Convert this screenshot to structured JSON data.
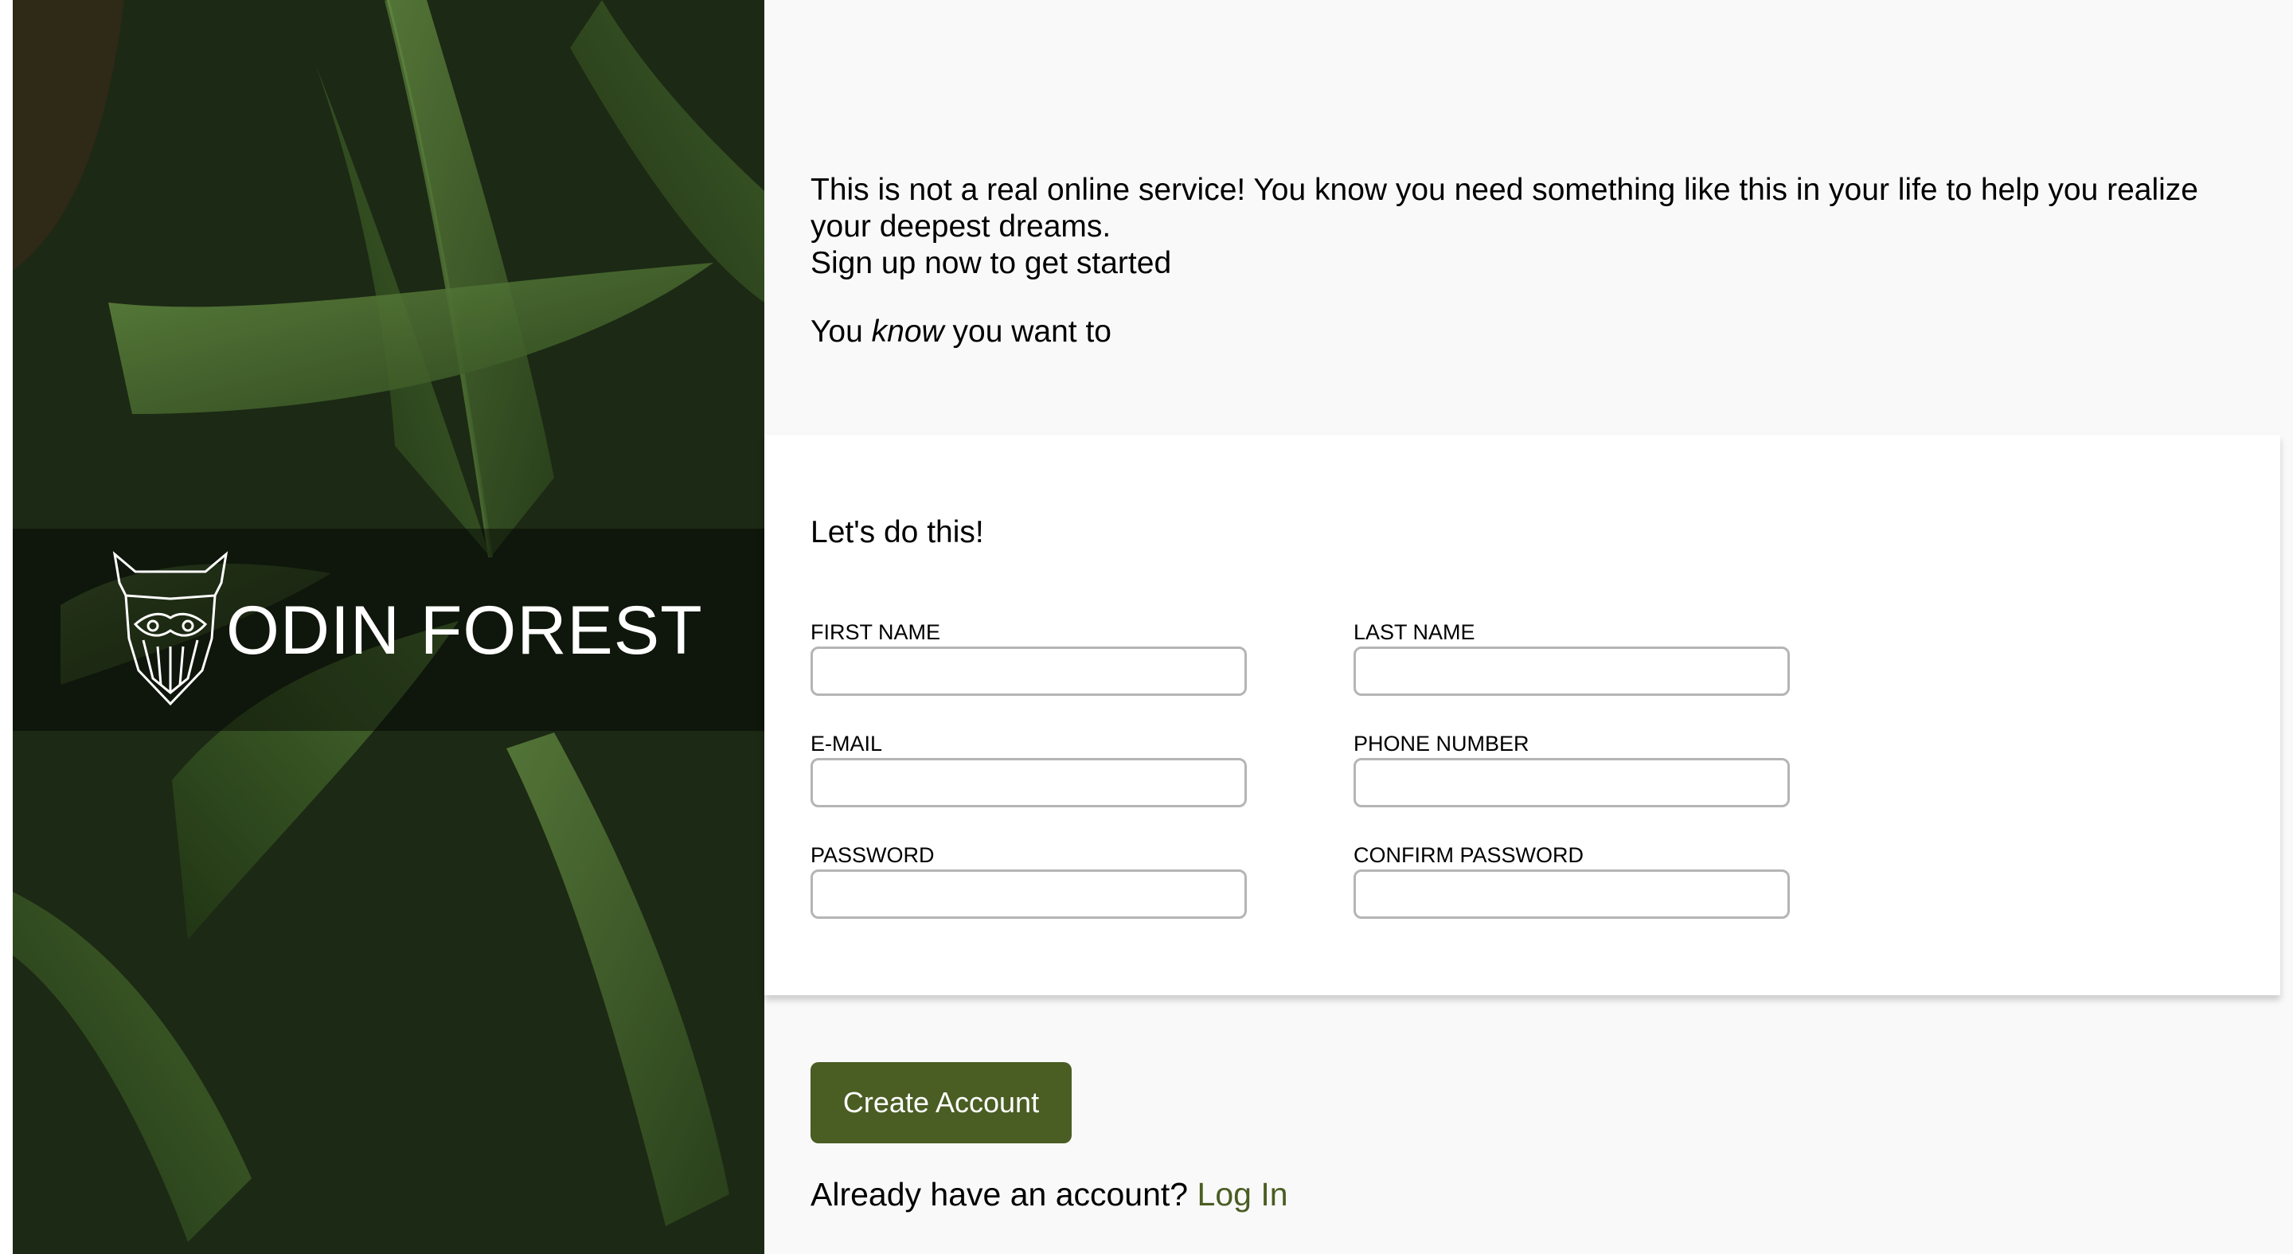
{
  "brand": {
    "name": "ODIN FOREST",
    "logo_icon": "viking-helmet-icon"
  },
  "intro": {
    "line1": "This is not a real online service! You know you need something like this in your life to help you realize your deepest dreams.",
    "line2": "Sign up now to get started",
    "line3_before": "You ",
    "line3_emphasis": "know",
    "line3_after": " you want to"
  },
  "form": {
    "heading": "Let's do this!",
    "fields": {
      "first_name": {
        "label": "FIRST NAME",
        "value": ""
      },
      "last_name": {
        "label": "LAST NAME",
        "value": ""
      },
      "email": {
        "label": "E-MAIL",
        "value": ""
      },
      "phone": {
        "label": "PHONE NUMBER",
        "value": ""
      },
      "password": {
        "label": "PASSWORD",
        "value": ""
      },
      "confirm_password": {
        "label": "CONFIRM PASSWORD",
        "value": ""
      }
    }
  },
  "actions": {
    "create_account": "Create Account",
    "login_prompt": "Already have an account?",
    "login_link": "Log In"
  },
  "colors": {
    "accent": "#4a5d23",
    "page_bg": "#f9f9f9",
    "card_bg": "#ffffff",
    "input_border": "#b5b5b5"
  }
}
